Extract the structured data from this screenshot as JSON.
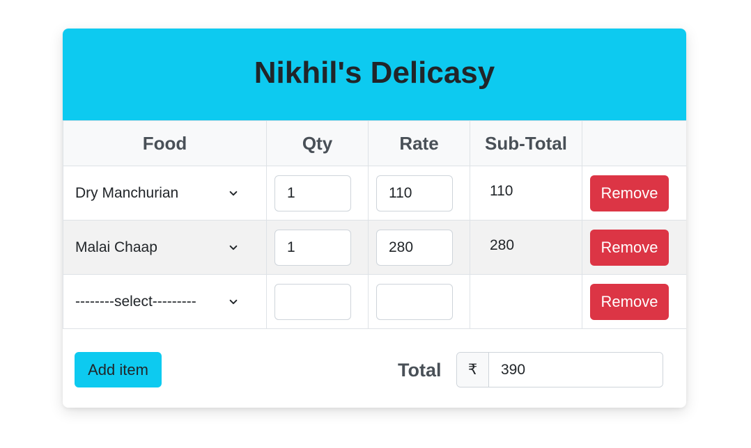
{
  "header": {
    "title": "Nikhil's Delicasy"
  },
  "table": {
    "columns": [
      "Food",
      "Qty",
      "Rate",
      "Sub-Total",
      ""
    ],
    "rows": [
      {
        "food": "Dry Manchurian",
        "qty": "1",
        "rate": "110",
        "subtotal": "110",
        "remove_label": "Remove"
      },
      {
        "food": "Malai Chaap",
        "qty": "1",
        "rate": "280",
        "subtotal": "280",
        "remove_label": "Remove"
      },
      {
        "food": "--------select---------",
        "qty": "",
        "rate": "",
        "subtotal": "",
        "remove_label": "Remove"
      }
    ]
  },
  "footer": {
    "add_label": "Add item",
    "total_label": "Total",
    "currency_symbol": "₹",
    "total_value": "390"
  },
  "colors": {
    "header_bg": "#0dcaf0",
    "remove_button": "#dc3545",
    "add_button": "#0dcaf0"
  }
}
